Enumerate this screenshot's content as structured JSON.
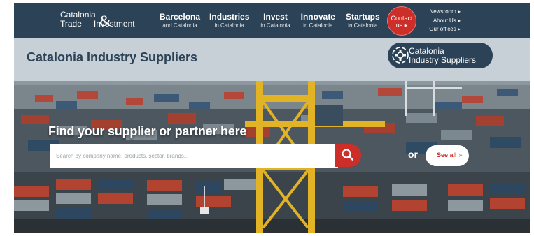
{
  "brand": {
    "line1": "Catalonia",
    "line2_left": "Trade",
    "ampersand": "&",
    "line2_right": "Investment"
  },
  "nav": [
    {
      "main": "Barcelona",
      "sub": "and Catalonia"
    },
    {
      "main": "Industries",
      "sub": "in Catalonia"
    },
    {
      "main": "Invest",
      "sub": "in Catalonia"
    },
    {
      "main": "Innovate",
      "sub": "in Catalonia"
    },
    {
      "main": "Startups",
      "sub": "in Catalonia"
    }
  ],
  "contact": {
    "line1": "Contact",
    "line2": "us ▸"
  },
  "links": [
    "Newsroom ▸",
    "About Us ▸",
    "Our offices ▸"
  ],
  "title": "Catalonia Industry Suppliers",
  "pill": {
    "line1": "Catalonia",
    "line2": "Industry Suppliers"
  },
  "hero": {
    "heading": "Find your supplier or partner here",
    "search_placeholder": "Search by company name, products, sector, brands...",
    "or": "or",
    "see_all": "See all",
    "see_all_chevron": "»"
  },
  "colors": {
    "navy": "#2c4256",
    "red": "#cc2f2a",
    "band": "#c6d0d6",
    "crane_yellow": "#e2b325"
  }
}
